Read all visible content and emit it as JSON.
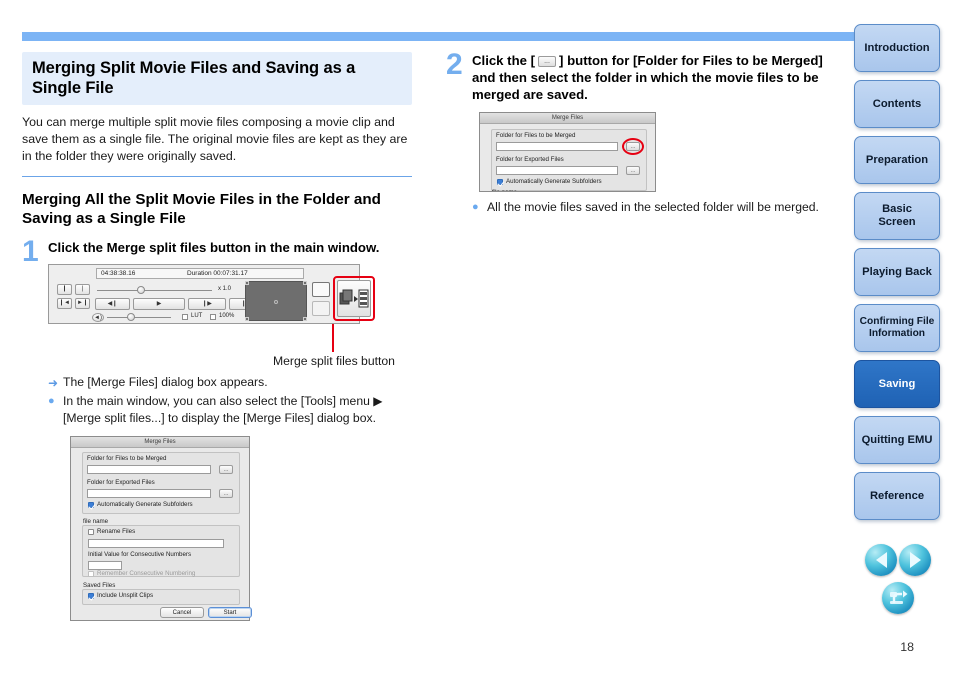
{
  "page": {
    "number": "18"
  },
  "left": {
    "h1": "Merging Split Movie Files and Saving as a Single File",
    "intro": "You can merge multiple split movie files composing a movie clip and save them as a single file. The original movie files are kept as they are in the folder they were originally saved.",
    "h2": "Merging All the Split Movie Files in the Folder and Saving as a Single File",
    "step1": {
      "num": "1",
      "title": "Click the Merge split files button in the main window.",
      "callout": "Merge split files button",
      "bullets": [
        {
          "marker": "arrow",
          "text": "The [Merge Files] dialog box appears."
        },
        {
          "marker": "dot",
          "text": "In the main window, you can also select the [Tools] menu ▶ [Merge split files...] to display the [Merge Files] dialog box."
        }
      ]
    }
  },
  "right": {
    "step2": {
      "num": "2",
      "title_a": "Click the [",
      "title_btn": "...",
      "title_b": "] button for [Folder for Files to be Merged] and then select the folder in which the movie files to be merged are saved.",
      "bullets": [
        {
          "marker": "dot",
          "text": "All the movie files saved in the selected folder will be merged."
        }
      ]
    }
  },
  "player": {
    "timecode": "04:38:38.16",
    "duration": "Duration 00:07:31.17",
    "speed": "x 1.0",
    "lut_label": "LUT",
    "zoom_label": "100%",
    "buttons": {
      "mark_in": "❙",
      "mark_out": "❘",
      "goto_in": "❙◄",
      "goto_out": "►❙",
      "prev_frame": "◀❙",
      "play": "▶",
      "next_frame": "❙▶",
      "end": "❙▶",
      "volume": "◄)"
    }
  },
  "dialog": {
    "title": "Merge Files",
    "folder_merged_label": "Folder for Files to be Merged",
    "folder_export_label": "Folder for Exported Files",
    "auto_subfolders_label": "Automatically Generate Subfolders",
    "file_name_group": "file name",
    "rename_files_label": "Rename Files",
    "initial_value_label": "Initial Value for Consecutive Numbers",
    "remember_numbering_label": "Remember Consecutive Numbering",
    "saved_files_group": "Saved Files",
    "include_unsplit_label": "Include Unsplit Clips",
    "browse_button": "...",
    "cancel_button": "Cancel",
    "start_button": "Start",
    "field_value": ""
  },
  "sidebar": {
    "items": [
      {
        "label": "Introduction",
        "active": false
      },
      {
        "label": "Contents",
        "active": false
      },
      {
        "label": "Preparation",
        "active": false
      },
      {
        "label": "Basic\nScreen",
        "active": false
      },
      {
        "label": "Playing Back",
        "active": false
      },
      {
        "label": "Confirming File\nInformation",
        "active": false
      },
      {
        "label": "Saving",
        "active": true
      },
      {
        "label": "Quitting EMU",
        "active": false
      },
      {
        "label": "Reference",
        "active": false
      }
    ]
  },
  "round_nav": {
    "prev": "previous-page",
    "next": "next-page",
    "back": "return"
  },
  "colors": {
    "accent_bar": "#7cb4f5",
    "heading_bg": "#e4eefb",
    "step_number": "#74aeee",
    "active_nav": "#2f76c8",
    "nav": "#b6cfee",
    "highlight": "#e60012"
  }
}
